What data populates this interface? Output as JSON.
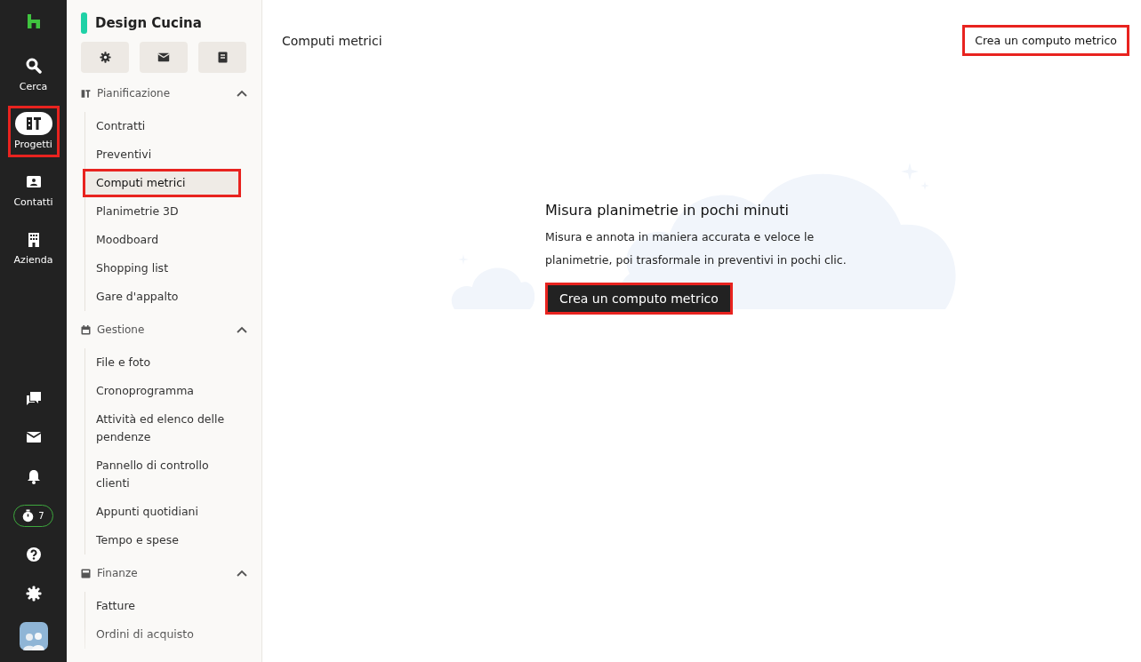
{
  "rail": {
    "items": [
      {
        "label": "Cerca",
        "selected": false,
        "highlighted": false
      },
      {
        "label": "Progetti",
        "selected": true,
        "highlighted": true
      },
      {
        "label": "Contatti",
        "selected": false,
        "highlighted": false
      },
      {
        "label": "Azienda",
        "selected": false,
        "highlighted": false
      }
    ],
    "timer_count": "7"
  },
  "project": {
    "name": "Design Cucina",
    "color": "#1fd1a6",
    "sections": [
      {
        "title": "Pianificazione",
        "expanded": true,
        "items": [
          {
            "label": "Contratti",
            "selected": false,
            "highlighted": false
          },
          {
            "label": "Preventivi",
            "selected": false,
            "highlighted": false
          },
          {
            "label": "Computi metrici",
            "selected": true,
            "highlighted": true
          },
          {
            "label": "Planimetrie 3D",
            "selected": false,
            "highlighted": false
          },
          {
            "label": "Moodboard",
            "selected": false,
            "highlighted": false
          },
          {
            "label": "Shopping list",
            "selected": false,
            "highlighted": false
          },
          {
            "label": "Gare d'appalto",
            "selected": false,
            "highlighted": false
          }
        ]
      },
      {
        "title": "Gestione",
        "expanded": true,
        "items": [
          {
            "label": "File e foto",
            "selected": false,
            "highlighted": false
          },
          {
            "label": "Cronoprogramma",
            "selected": false,
            "highlighted": false
          },
          {
            "label": "Attività ed elenco delle pendenze",
            "selected": false,
            "highlighted": false
          },
          {
            "label": "Pannello di controllo clienti",
            "selected": false,
            "highlighted": false
          },
          {
            "label": "Appunti quotidiani",
            "selected": false,
            "highlighted": false
          },
          {
            "label": "Tempo e spese",
            "selected": false,
            "highlighted": false
          }
        ]
      },
      {
        "title": "Finanze",
        "expanded": true,
        "items": [
          {
            "label": "Fatture",
            "selected": false,
            "highlighted": false
          },
          {
            "label": "Ordini di acquisto",
            "selected": false,
            "highlighted": false
          }
        ]
      }
    ]
  },
  "main": {
    "title": "Computi metrici",
    "header_button": {
      "label": "Crea un computo metrico",
      "highlighted": true
    },
    "empty_state": {
      "heading": "Misura planimetrie in pochi minuti",
      "text": "Misura e annota in maniera accurata e veloce le planimetrie, poi trasformale in preventivi in pochi clic.",
      "button": {
        "label": "Crea un computo metrico",
        "highlighted": true
      }
    }
  }
}
